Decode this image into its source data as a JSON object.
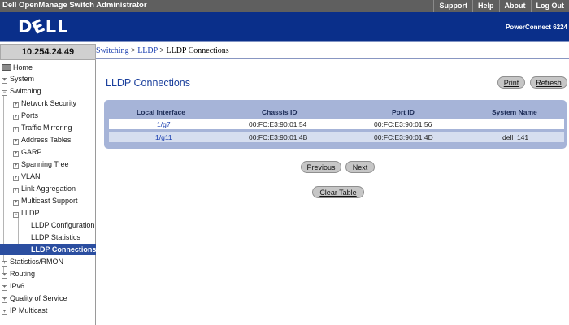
{
  "app": {
    "title": "Dell OpenManage Switch Administrator",
    "nav": [
      "Support",
      "Help",
      "About",
      "Log Out"
    ],
    "logo": "DELL",
    "product": "PowerConnect 6224"
  },
  "ip_address": "10.254.24.49",
  "breadcrumb": {
    "items": [
      "Switching",
      "LLDP"
    ],
    "current": "LLDP Connections",
    "separator": ">"
  },
  "sidebar": {
    "home": "Home",
    "system": "System",
    "switching": "Switching",
    "network_security": "Network Security",
    "ports": "Ports",
    "traffic_mirroring": "Traffic Mirroring",
    "address_tables": "Address Tables",
    "garp": "GARP",
    "spanning_tree": "Spanning Tree",
    "vlan": "VLAN",
    "link_aggregation": "Link Aggregation",
    "multicast_support": "Multicast Support",
    "lldp": "LLDP",
    "lldp_configuration": "LLDP Configuration",
    "lldp_statistics": "LLDP Statistics",
    "lldp_connections": "LLDP Connections",
    "statistics_rmon": "Statistics/RMON",
    "routing": "Routing",
    "ipv6": "IPv6",
    "quality_of_service": "Quality of Service",
    "ip_multicast": "IP Multicast"
  },
  "main": {
    "title": "LLDP Connections",
    "print_label": "Print",
    "refresh_label": "Refresh",
    "previous_label": "Previous",
    "next_label": "Next",
    "clear_table_label": "Clear Table"
  },
  "table": {
    "columns": [
      "Local Interface",
      "Chassis ID",
      "Port ID",
      "System Name"
    ],
    "rows": [
      {
        "local_interface": "1/g7",
        "chassis_id": "00:FC:E3:90:01:54",
        "port_id": "00:FC:E3:90:01:56",
        "system_name": ""
      },
      {
        "local_interface": "1/g11",
        "chassis_id": "00:FC:E3:90:01:4B",
        "port_id": "00:FC:E3:90:01:4D",
        "system_name": "dell_141"
      }
    ]
  },
  "colors": {
    "top_bar": "#5f5f5f",
    "brand_bar": "#0a2f8a",
    "title_blue": "#1a3f9c",
    "table_panel": "#a6b4d8",
    "selected_item": "#2b4ea0",
    "button": "#c6c6c6"
  },
  "icons": {
    "home": "home-icon",
    "expand": "plus-box-icon",
    "collapse": "minus-box-icon"
  }
}
